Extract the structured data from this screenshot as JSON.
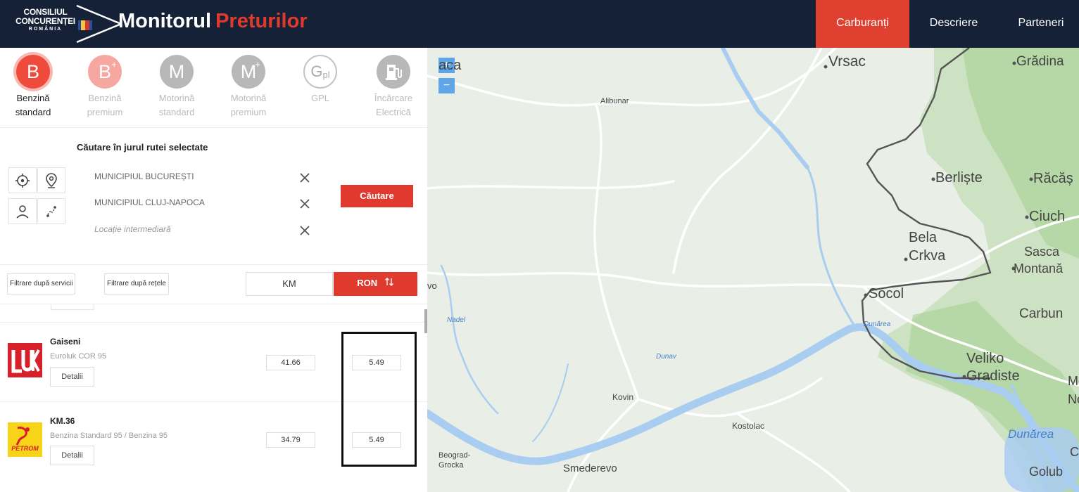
{
  "header": {
    "logo_line1": "CONSILIUL",
    "logo_line2": "CONCURENȚEI",
    "logo_line3": "ROMÂNIA",
    "title_part1": "Monitorul",
    "title_part2": "Preturilor",
    "nav": [
      {
        "label": "Carburanți",
        "active": true
      },
      {
        "label": "Descriere",
        "active": false
      },
      {
        "label": "Parteneri",
        "active": false
      }
    ]
  },
  "fuel_types": [
    {
      "letter": "B",
      "sup": "",
      "line1": "Benzină",
      "line2": "standard",
      "active": true
    },
    {
      "letter": "B",
      "sup": "+",
      "line1": "Benzină",
      "line2": "premium",
      "active": false
    },
    {
      "letter": "M",
      "sup": "",
      "line1": "Motorină",
      "line2": "standard",
      "active": false
    },
    {
      "letter": "M",
      "sup": "+",
      "line1": "Motorină",
      "line2": "premium",
      "active": false
    },
    {
      "letter": "G",
      "sup": "pl",
      "line1": "GPL",
      "line2": "",
      "active": false
    },
    {
      "letter": "",
      "sup": "",
      "line1": "Încărcare",
      "line2": "Electrică",
      "active": false
    }
  ],
  "route": {
    "title": "Căutare în jurul rutei selectate",
    "from": "MUNICIPIUL BUCUREȘTI",
    "to": "MUNICIPIUL CLUJ-NAPOCA",
    "intermediate_placeholder": "Locație intermediară",
    "search_label": "Căutare"
  },
  "filters": {
    "services": "Filtrare după servicii",
    "networks": "Filtrare după rețele",
    "sort_km": "KM",
    "sort_ron": "RON",
    "active_sort": "RON"
  },
  "stations": [
    {
      "name": "Gaiseni",
      "fuel": "Euroluk COR 95",
      "distance": "41.66",
      "price": "5.49",
      "brand": "LUKOIL",
      "details": "Detalii"
    },
    {
      "name": "KM.36",
      "fuel": "Benzina Standard 95 / Benzina 95",
      "distance": "34.79",
      "price": "5.49",
      "brand": "PETROM",
      "details": "Detalii"
    }
  ],
  "map": {
    "zoom_in": "+",
    "zoom_out": "−",
    "labels": [
      "Vrsac",
      "Grădina",
      "Alibunar",
      "Berliște",
      "Răcăș",
      "Ciuch",
      "Bela",
      "Crkva",
      "Sasca",
      "Montană",
      "Socol",
      "Carbun",
      "Veliko",
      "Gradiste",
      "Kovin",
      "Kostolac",
      "Beograd-",
      "Grocka",
      "Smederevo",
      "Golub",
      "Dunărea",
      "Nadel",
      "Dunav",
      "Dunărea",
      "aca",
      "vo",
      "Mo",
      "No",
      "C"
    ],
    "colors": {
      "water": "#a9cdf0",
      "forest": "#b7d9a6",
      "land": "#e9eee6",
      "border": "#555555"
    }
  }
}
